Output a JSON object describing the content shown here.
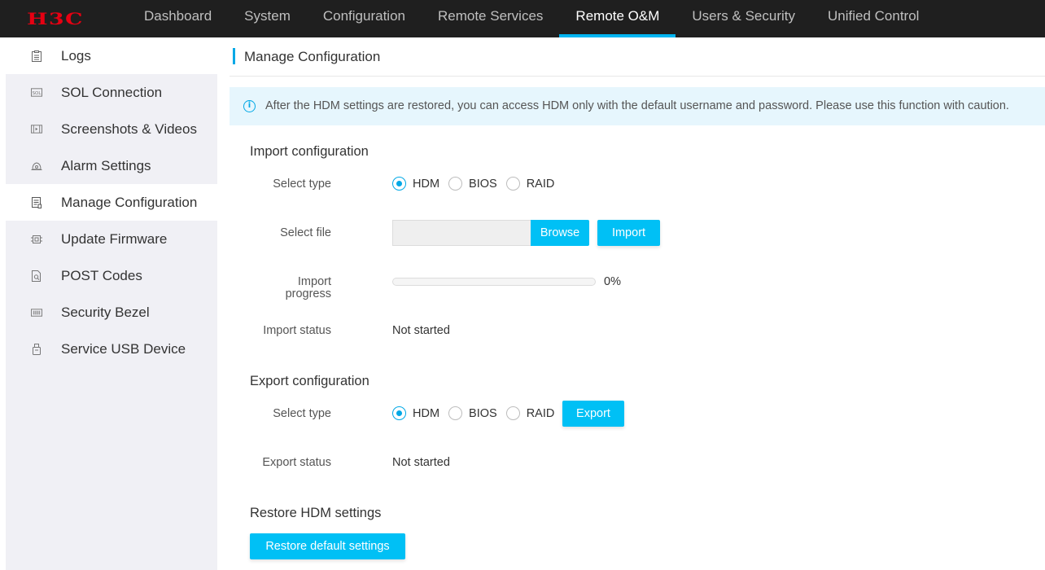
{
  "brand": {
    "logo_text": "H3C",
    "logo_color": "#e60012",
    "accent": "#00a8e6"
  },
  "nav": {
    "items": [
      {
        "label": "Dashboard",
        "active": false
      },
      {
        "label": "System",
        "active": false
      },
      {
        "label": "Configuration",
        "active": false
      },
      {
        "label": "Remote Services",
        "active": false
      },
      {
        "label": "Remote O&M",
        "active": true
      },
      {
        "label": "Users & Security",
        "active": false
      },
      {
        "label": "Unified Control",
        "active": false
      }
    ]
  },
  "sidebar": {
    "items": [
      {
        "label": "Logs",
        "icon": "logs-icon"
      },
      {
        "label": "SOL Connection",
        "icon": "sol-icon"
      },
      {
        "label": "Screenshots & Videos",
        "icon": "video-icon"
      },
      {
        "label": "Alarm Settings",
        "icon": "alarm-icon"
      },
      {
        "label": "Manage Configuration",
        "icon": "config-icon",
        "active": true
      },
      {
        "label": "Update Firmware",
        "icon": "chip-icon"
      },
      {
        "label": "POST Codes",
        "icon": "document-search-icon"
      },
      {
        "label": "Security Bezel",
        "icon": "bezel-icon"
      },
      {
        "label": "Service USB Device",
        "icon": "usb-icon"
      }
    ]
  },
  "page": {
    "title": "Manage Configuration",
    "notice": "After the HDM settings are restored, you can access HDM only with the default username and password. Please use this function with caution."
  },
  "import": {
    "title": "Import configuration",
    "select_type_label": "Select type",
    "types": [
      "HDM",
      "BIOS",
      "RAID"
    ],
    "selected_type": "HDM",
    "select_file_label": "Select file",
    "file_value": "",
    "browse_label": "Browse",
    "import_label": "Import",
    "progress_label": "Import progress",
    "progress_percent": 0,
    "progress_text": "0%",
    "status_label": "Import status",
    "status_value": "Not started"
  },
  "export": {
    "title": "Export configuration",
    "select_type_label": "Select type",
    "types": [
      "HDM",
      "BIOS",
      "RAID"
    ],
    "selected_type": "HDM",
    "export_label": "Export",
    "status_label": "Export status",
    "status_value": "Not started"
  },
  "restore": {
    "title": "Restore HDM settings",
    "button_label": "Restore default settings"
  }
}
